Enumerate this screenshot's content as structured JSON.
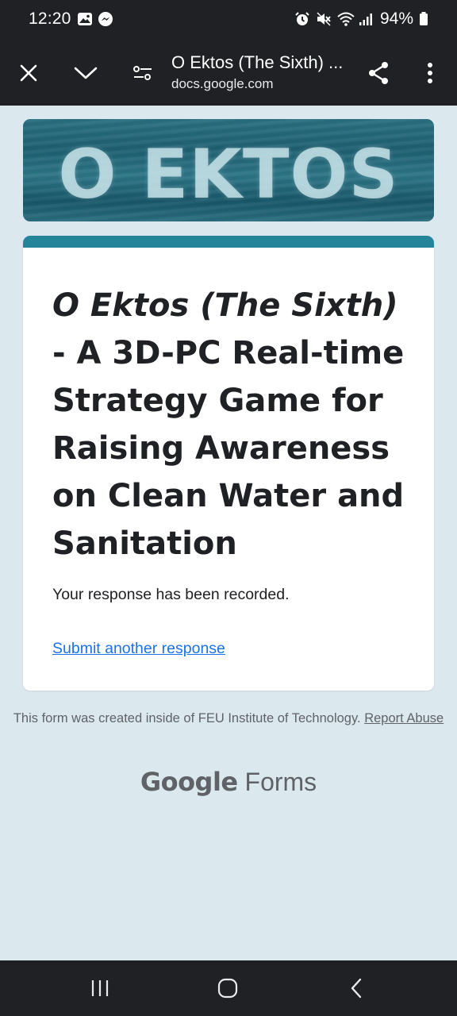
{
  "status_bar": {
    "time": "12:20",
    "battery": "94%",
    "left_icons": [
      "image-icon",
      "messenger-icon"
    ],
    "right_icons": [
      "alarm-icon",
      "mute-icon",
      "wifi-icon",
      "signal-icon",
      "battery-icon"
    ]
  },
  "browser": {
    "title": "O Ektos (The Sixth) ...",
    "url": "docs.google.com"
  },
  "form": {
    "banner_text": "O EKTOS",
    "accent_color": "#24849a",
    "title_italic": "O Ektos (The Sixth)",
    "title_rest": " - A 3D-PC Real-time Strategy Game for Raising Awareness on Clean Water and Sanitation",
    "response_message": "Your response has been recorded.",
    "submit_another": "Submit another response"
  },
  "footer": {
    "note": "This form was created inside of FEU Institute of Technology.",
    "report_abuse": "Report Abuse",
    "brand_google": "Google",
    "brand_forms": "Forms"
  }
}
